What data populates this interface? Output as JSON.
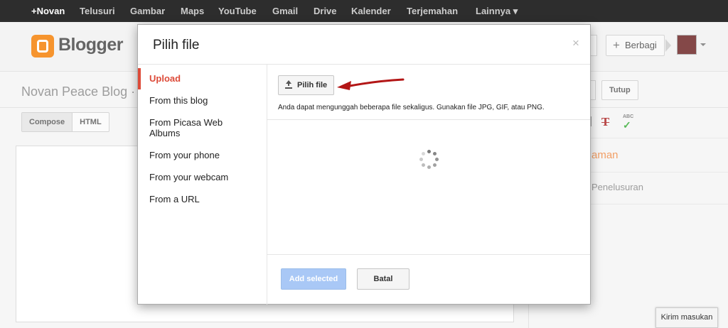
{
  "gbar": {
    "items": [
      "+Novan",
      "Telusuri",
      "Gambar",
      "Maps",
      "YouTube",
      "Gmail",
      "Drive",
      "Kalender",
      "Terjemahan",
      "Lainnya ▾"
    ]
  },
  "header": {
    "logo_text": "Blogger",
    "share_label": "Berbagi"
  },
  "editor": {
    "post_title": "Novan Peace Blog ·",
    "tabs": [
      "Compose",
      "HTML"
    ],
    "close_label": "Tutup",
    "side_orange": "aman",
    "side_gray": "Penelusuran"
  },
  "dialog": {
    "title": "Pilih file",
    "close_glyph": "×",
    "nav": [
      "Upload",
      "From this blog",
      "From Picasa Web Albums",
      "From your phone",
      "From your webcam",
      "From a URL"
    ],
    "active_nav": "Upload",
    "pick_button": "Pilih file",
    "hint": "Anda dapat mengunggah beberapa file sekaligus. Gunakan file JPG, GIF, atau PNG.",
    "add_selected": "Add selected",
    "cancel": "Batal"
  },
  "feedback": "Kirim masukan",
  "colors": {
    "active_nav": "#dd4b39",
    "primary_disabled": "#a9c8f6",
    "annotation_arrow": "#b31616",
    "blogger_orange": "#f57d00"
  },
  "icons": [
    "upload-icon",
    "close-icon",
    "loading-spinner",
    "plus-icon",
    "clear-format-icon",
    "spellcheck-icon"
  ]
}
